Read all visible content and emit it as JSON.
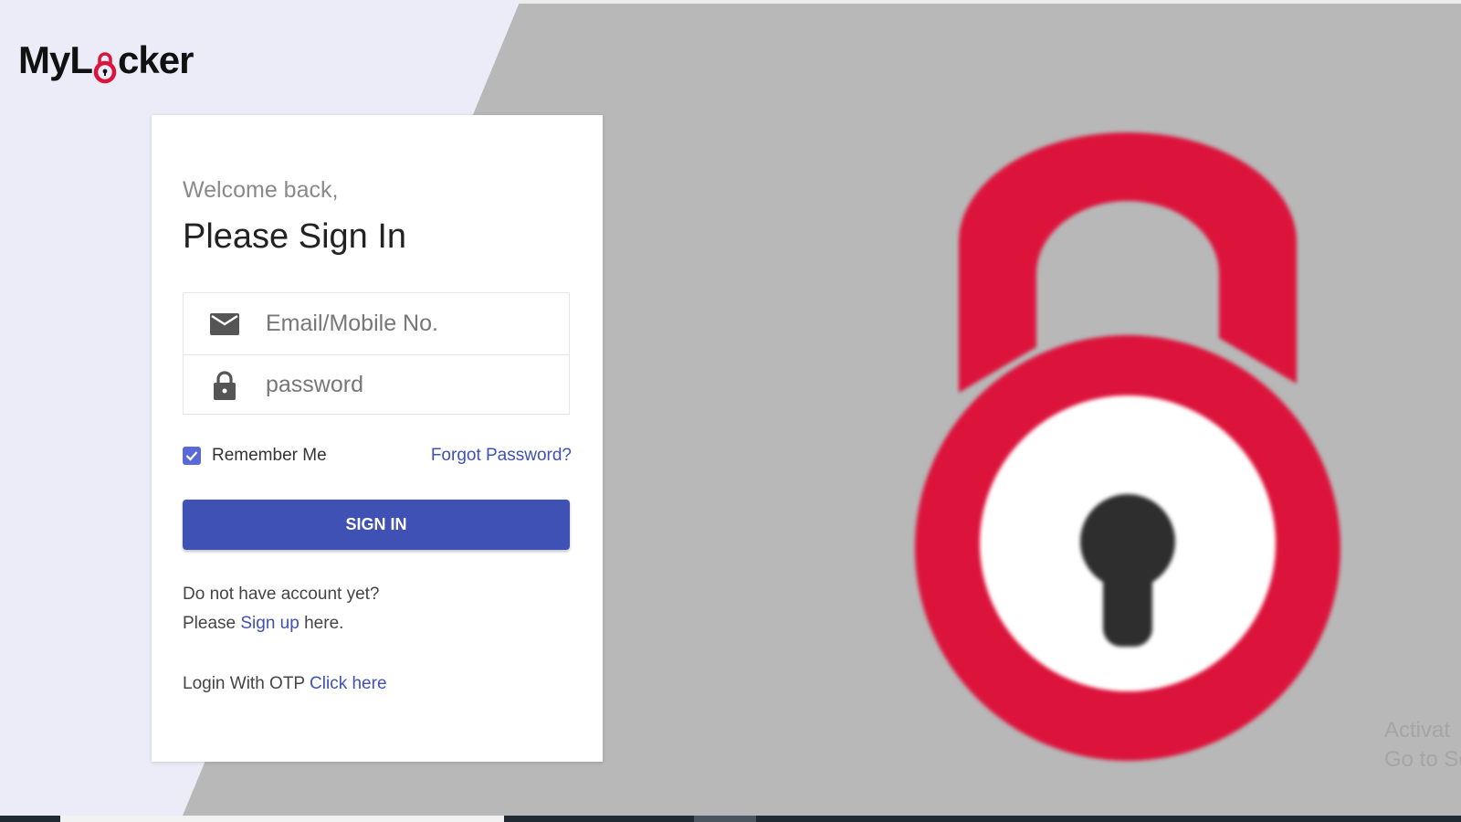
{
  "logo": {
    "text_before": "MyL",
    "text_after": "cker",
    "accent": "#dc143c"
  },
  "login": {
    "welcome": "Welcome back,",
    "title": "Please Sign In",
    "email_placeholder": "Email/Mobile No.",
    "password_placeholder": "password",
    "remember_label": "Remember Me",
    "remember_checked": true,
    "forgot_label": "Forgot Password?",
    "signin_label": "SIGN IN",
    "no_account_text": "Do not have account yet?",
    "please_text": "Please ",
    "signup_link": "Sign up",
    "here_text": " here.",
    "otp_text": "Login With OTP ",
    "otp_link": "Click here"
  },
  "icons": {
    "email": "mail-icon",
    "password": "lock-icon",
    "checkbox": "check-icon",
    "hero": "padlock-icon"
  },
  "watermark": {
    "line1": "Activat",
    "line2": "Go to Set"
  },
  "colors": {
    "primary": "#3f51b5",
    "accent": "#dc143c",
    "panel": "#ebecf8",
    "background": "#b8b8b8"
  }
}
